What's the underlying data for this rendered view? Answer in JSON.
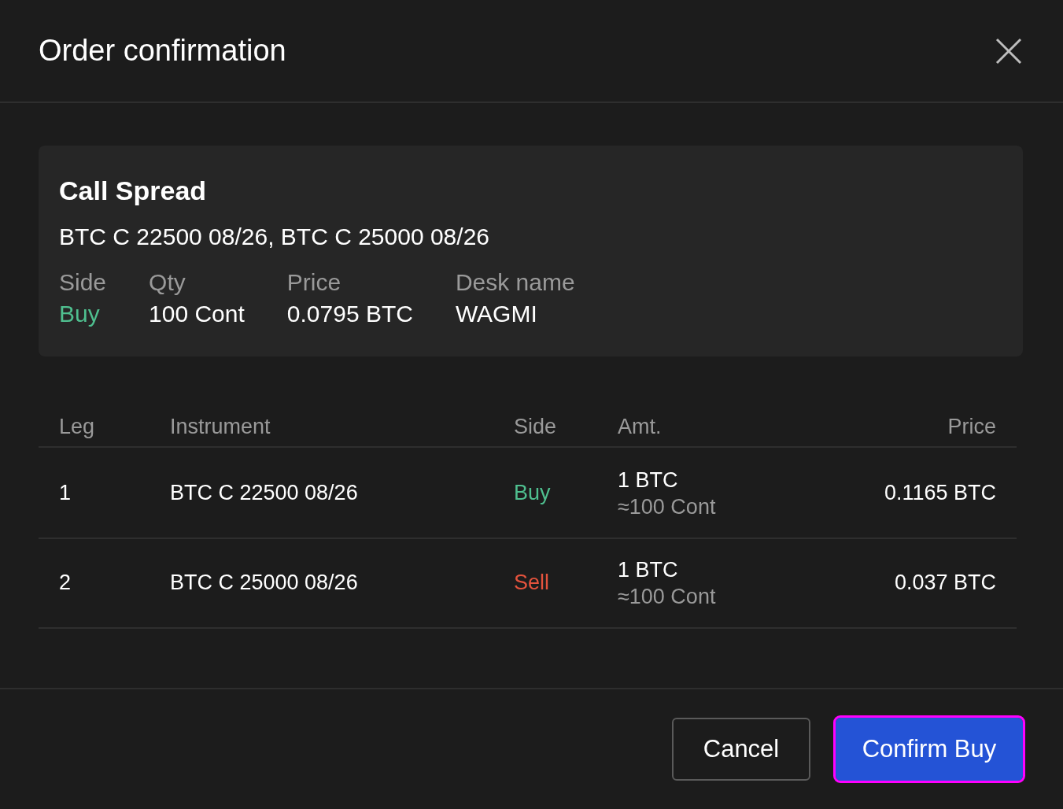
{
  "dialog": {
    "title": "Order confirmation"
  },
  "summary": {
    "strategy": "Call Spread",
    "instruments": "BTC C 22500 08/26, BTC C 25000 08/26",
    "fields": [
      {
        "label": "Side",
        "value": "Buy",
        "kind": "buy"
      },
      {
        "label": "Qty",
        "value": "100 Cont",
        "kind": "plain"
      },
      {
        "label": "Price",
        "value": "0.0795 BTC",
        "kind": "plain"
      },
      {
        "label": "Desk name",
        "value": "WAGMI",
        "kind": "plain"
      }
    ]
  },
  "table": {
    "columns": [
      "Leg",
      "Instrument",
      "Side",
      "Amt.",
      "Price"
    ],
    "rows": [
      {
        "leg": "1",
        "instrument": "BTC C 22500 08/26",
        "side": "Buy",
        "kind": "buy",
        "amount": "1 BTC",
        "amount_approx": "≈100 Cont",
        "price": "0.1165 BTC"
      },
      {
        "leg": "2",
        "instrument": "BTC C 25000 08/26",
        "side": "Sell",
        "kind": "sell",
        "amount": "1 BTC",
        "amount_approx": "≈100 Cont",
        "price": "0.037 BTC"
      }
    ]
  },
  "buttons": [
    {
      "label": "Cancel",
      "kind": "secondary",
      "focused": false
    },
    {
      "label": "Confirm Buy",
      "kind": "primary",
      "focused": true
    }
  ]
}
